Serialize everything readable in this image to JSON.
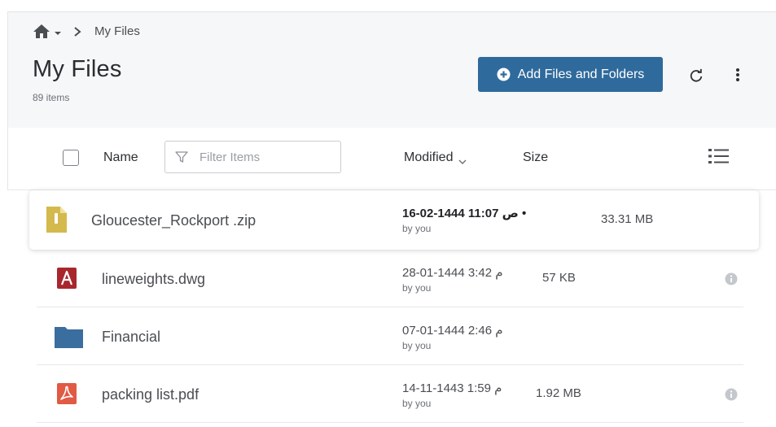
{
  "breadcrumb": {
    "current": "My Files"
  },
  "header": {
    "title": "My Files",
    "item_count": "89 items",
    "add_button_label": "Add Files and Folders"
  },
  "columns": {
    "name": "Name",
    "filter_placeholder": "Filter Items",
    "modified": "Modified",
    "size": "Size"
  },
  "files": [
    {
      "name": "Gloucester_Rockport .zip",
      "modified": "16-02-1444 11:07 ص •",
      "by": "by you",
      "size": "33.31 MB",
      "icon": "zip-file-icon",
      "selected": true
    },
    {
      "name": "lineweights.dwg",
      "modified": "28-01-1444 3:42 م",
      "by": "by you",
      "size": "57 KB",
      "icon": "dwg-file-icon"
    },
    {
      "name": "Financial",
      "modified": "07-01-1444 2:46 م",
      "by": "by you",
      "size": "",
      "icon": "folder-icon"
    },
    {
      "name": "packing list.pdf",
      "modified": "14-11-1443 1:59 م",
      "by": "by you",
      "size": "1.92 MB",
      "icon": "pdf-file-icon"
    }
  ],
  "colors": {
    "accent": "#2f6a9c",
    "zip": "#d4b94c",
    "dwg": "#a8272d",
    "folder": "#3a6e9e",
    "pdf": "#e05a44"
  }
}
